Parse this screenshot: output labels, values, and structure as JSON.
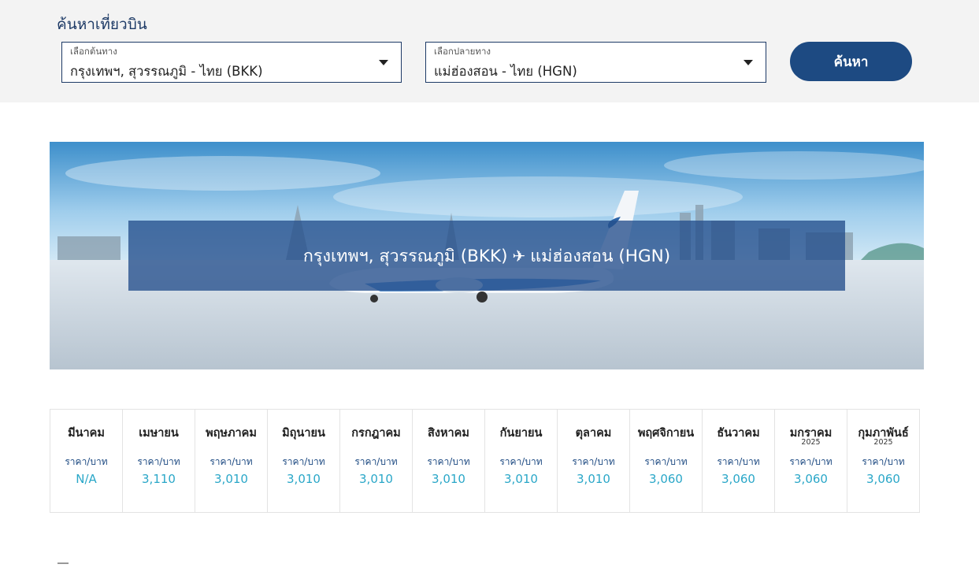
{
  "search": {
    "heading": "ค้นหาเที่ยวบิน",
    "origin": {
      "label": "เลือกต้นทาง",
      "value": "กรุงเทพฯ, สุวรรณภูมิ - ไทย (BKK)"
    },
    "destination": {
      "label": "เลือกปลายทาง",
      "value": "แม่ฮ่องสอน - ไทย (HGN)"
    },
    "button_label": "ค้นหา"
  },
  "hero": {
    "origin_text": "กรุงเทพฯ, สุวรรณภูมิ (BKK)",
    "plane_glyph": "✈",
    "destination_text": "แม่ฮ่องสอน (HGN)"
  },
  "fares": [
    {
      "month": "มีนาคม",
      "year": "",
      "unit": "ราคา/บาท",
      "price": "N/A"
    },
    {
      "month": "เมษายน",
      "year": "",
      "unit": "ราคา/บาท",
      "price": "3,110"
    },
    {
      "month": "พฤษภาคม",
      "year": "",
      "unit": "ราคา/บาท",
      "price": "3,010"
    },
    {
      "month": "มิถุนายน",
      "year": "",
      "unit": "ราคา/บาท",
      "price": "3,010"
    },
    {
      "month": "กรกฎาคม",
      "year": "",
      "unit": "ราคา/บาท",
      "price": "3,010"
    },
    {
      "month": "สิงหาคม",
      "year": "",
      "unit": "ราคา/บาท",
      "price": "3,010"
    },
    {
      "month": "กันยายน",
      "year": "",
      "unit": "ราคา/บาท",
      "price": "3,010"
    },
    {
      "month": "ตุลาคม",
      "year": "",
      "unit": "ราคา/บาท",
      "price": "3,010"
    },
    {
      "month": "พฤศจิกายน",
      "year": "",
      "unit": "ราคา/บาท",
      "price": "3,060"
    },
    {
      "month": "ธันวาคม",
      "year": "",
      "unit": "ราคา/บาท",
      "price": "3,060"
    },
    {
      "month": "มกราคม",
      "year": "2025",
      "unit": "ราคา/บาท",
      "price": "3,060"
    },
    {
      "month": "กุมภาพันธ์",
      "year": "2025",
      "unit": "ราคา/บาท",
      "price": "3,060"
    }
  ],
  "colors": {
    "brand_navy": "#1d4a82",
    "price_teal": "#2aa7c8",
    "panel_gray": "#f3f3f3"
  }
}
